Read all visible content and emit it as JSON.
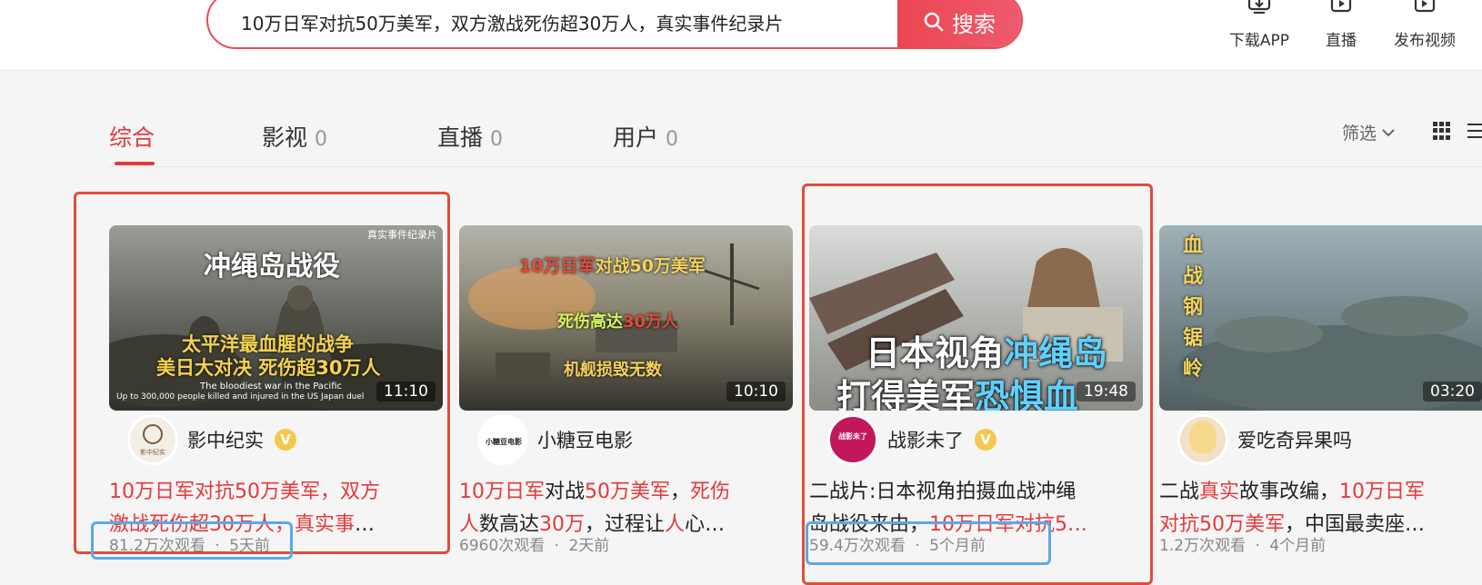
{
  "search": {
    "query": "10万日军对抗50万美军，双方激战死伤超30万人，真实事件纪录片",
    "button": "搜索"
  },
  "header": {
    "download": "下载APP",
    "live": "直播",
    "publish": "发布视频"
  },
  "tabs": [
    {
      "label": "综合",
      "count": ""
    },
    {
      "label": "影视",
      "count": "0"
    },
    {
      "label": "直播",
      "count": "0"
    },
    {
      "label": "用户",
      "count": "0"
    }
  ],
  "filter": "筛选",
  "cards": [
    {
      "thumb_title": "冲绳岛战役",
      "thumb_tag": "真实事件纪录片",
      "thumb_line1": "太平洋最血腥的战争",
      "thumb_line2": "美日大对决 死伤超30万人",
      "thumb_en1": "The bloodiest war in the Pacific",
      "thumb_en2": "Up to 300,000 people killed and injured in the US Japan duel",
      "duration": "11:10",
      "avatar_text": "影中纪实",
      "author": "影中纪实",
      "verified": "V",
      "title_parts": [
        "10万日军对抗50万美军，双方",
        "激战死伤超30万人，真实事",
        "…"
      ],
      "views": "81.2万次观看",
      "dot": "·",
      "time": "5天前"
    },
    {
      "thumb_line1a": "10万",
      "thumb_line1b": "日军",
      "thumb_line1c": "对战50万美军",
      "thumb_line2a": "死伤高达",
      "thumb_line2b": "30万人",
      "thumb_line3": "机舰损毁无数",
      "duration": "10:10",
      "avatar_text": "小糖豆电影",
      "author": "小糖豆电影",
      "title_parts": [
        "10万日军",
        "对战",
        "50万美军",
        "，",
        "死伤",
        "人",
        "数高达",
        "30万",
        "，过程让",
        "人",
        "心…"
      ],
      "views": "6960次观看",
      "dot": "·",
      "time": "2天前"
    },
    {
      "thumb_line1a": "日本视角",
      "thumb_line1b": "冲绳岛",
      "thumb_line2a": "打得美军",
      "thumb_line2b": "恐惧血",
      "duration": "19:48",
      "avatar_text": "战影未了",
      "author": "战影未了",
      "verified": "V",
      "title_parts": [
        "二战片:日本视角拍摄血战冲绳",
        "岛战役来由，",
        "10万日军对抗5…"
      ],
      "views": "59.4万次观看",
      "dot": "·",
      "time": "5个月前"
    },
    {
      "thumb_vertical": [
        "血",
        "战",
        "钢",
        "锯",
        "岭"
      ],
      "duration": "03:20",
      "author": "爱吃奇异果吗",
      "title_parts": [
        "二战",
        "真实",
        "故事改编，",
        "10万日军",
        "对抗50万美军",
        "，中国最卖座…"
      ],
      "views": "1.2万次观看",
      "dot": "·",
      "time": "4个月前"
    }
  ],
  "colors": {
    "accent": "#e4393c",
    "annotation_red": "#e04c3a",
    "annotation_blue": "#5aa9e6"
  }
}
